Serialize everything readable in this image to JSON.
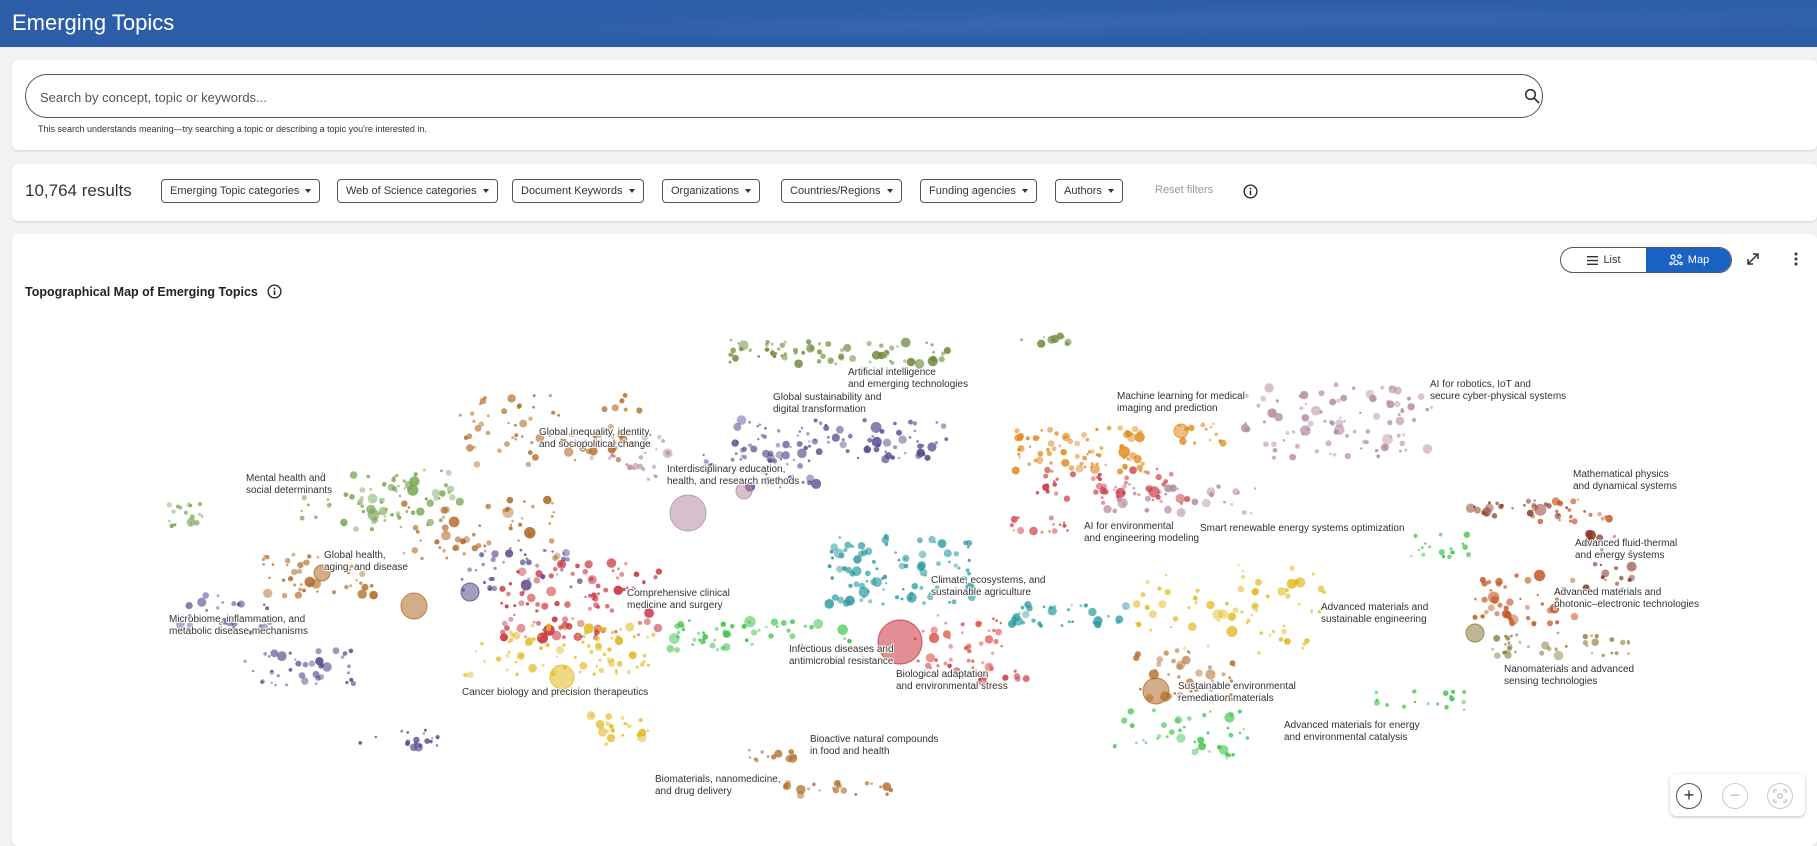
{
  "header": {
    "title": "Emerging Topics"
  },
  "search": {
    "placeholder": "Search by concept, topic or keywords...",
    "hint": "This search understands meaning—try searching a topic or describing a topic you're interested in."
  },
  "filters": {
    "results": "10,764 results",
    "buttons": [
      "Emerging Topic categories",
      "Web of Science categories",
      "Document Keywords",
      "Organizations",
      "Countries/Regions",
      "Funding agencies",
      "Authors"
    ],
    "reset": "Reset filters"
  },
  "map": {
    "title": "Topographical Map of Emerging Topics",
    "view_toggle": {
      "list": "List",
      "map": "Map",
      "selected": "Map"
    },
    "labels": [
      [
        "Artificial intelligence",
        "and emerging technologies"
      ],
      [
        "Global sustainability and",
        "digital transformation"
      ],
      [
        "Machine learning for medical",
        "imaging and prediction"
      ],
      [
        "AI for robotics, IoT and",
        "secure cyber-physical systems"
      ],
      [
        "Global inequality, identity,",
        "and sociopolitical change"
      ],
      [
        "Mental health and",
        "social determinants"
      ],
      [
        "Interdisciplinary education,",
        "health, and research methods"
      ],
      [
        "Mathematical physics",
        "and dynamical systems"
      ],
      [
        "AI for environmental",
        "and engineering modeling"
      ],
      [
        "Smart renewable energy systems optimization"
      ],
      [
        "Global health,",
        "aging, and disease"
      ],
      [
        "Advanced fluid-thermal",
        "and energy systems"
      ],
      [
        "Climate, ecosystems, and",
        "sustainable agriculture"
      ],
      [
        "Comprehensive clinical",
        "medicine and surgery"
      ],
      [
        "Advanced materials and",
        "photonic–electronic technologies"
      ],
      [
        "Advanced materials and",
        "sustainable engineering"
      ],
      [
        "Microbiome, inflammation, and",
        "metabolic disease mechanisms"
      ],
      [
        "Infectious diseases and",
        "antimicrobial resistance"
      ],
      [
        "Nanomaterials and advanced",
        "sensing technologies"
      ],
      [
        "Biological adaptation",
        "and environmental stress"
      ],
      [
        "Cancer biology and precision therapeutics"
      ],
      [
        "Sustainable environmental",
        "remediation materials"
      ],
      [
        "Advanced materials for energy",
        "and environmental catalysis"
      ],
      [
        "Bioactive natural compounds",
        "in food and health"
      ],
      [
        "Biomaterials, nanomedicine,",
        "and drug delivery"
      ]
    ],
    "cluster_colors": {
      "olive": "#6f8a3a",
      "purple": "#5b4a8f",
      "orange": "#e08a1e",
      "mauve": "#b48ca3",
      "brown": "#b06a26",
      "green": "#7aa855",
      "red": "#c8323c",
      "teal": "#2a9aa0",
      "yellow": "#e2b81c",
      "lime": "#3cc24a",
      "rust": "#c45a28",
      "darkred": "#8a3a2a",
      "khaki": "#8a7a3a",
      "salmon": "#e0524a"
    }
  },
  "icons": {
    "search": "search-icon",
    "info": "info-icon",
    "list": "list-icon",
    "map": "map-icon",
    "expand": "expand-icon",
    "more": "more-vertical-icon",
    "zoom_in": "zoom-in-icon",
    "zoom_out": "zoom-out-icon",
    "fit": "fit-view-icon"
  }
}
